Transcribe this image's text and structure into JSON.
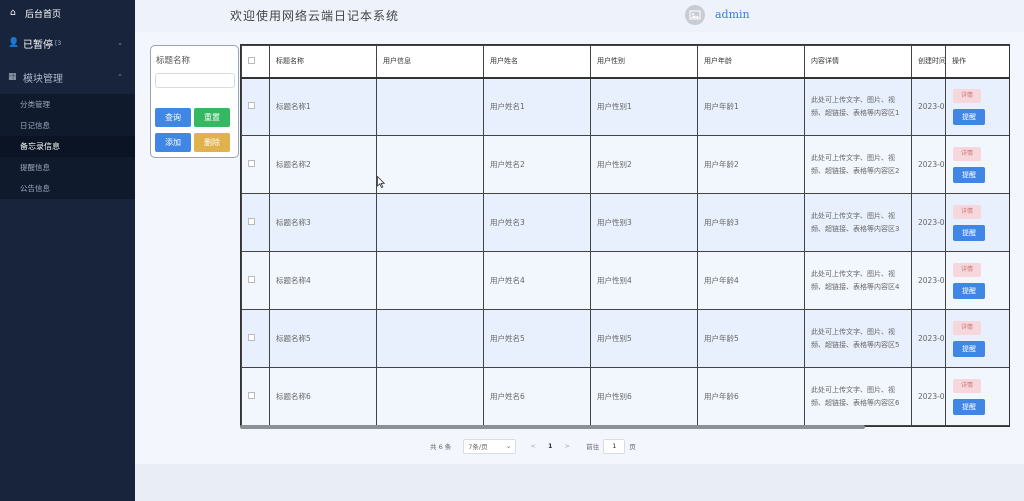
{
  "sidebar": {
    "home": "后台首页",
    "group1": "已暂停",
    "group1_sup": "[3",
    "group2": "模块管理",
    "items": [
      "分类管理",
      "日记信息",
      "备忘录信息",
      "提醒信息",
      "公告信息"
    ],
    "active_index": 2
  },
  "header": {
    "title": "欢迎使用网络云端日记本系统",
    "user": "admin"
  },
  "search": {
    "label": "标题名称",
    "placeholder": "",
    "query": "查询",
    "reset": "重置",
    "add": "添加",
    "delete": "删除"
  },
  "table": {
    "columns": [
      "标题名称",
      "用户信息",
      "用户姓名",
      "用户性别",
      "用户年龄",
      "内容详情",
      "创建时间",
      "操作"
    ],
    "rows": [
      {
        "title": "标题名称1",
        "info": "",
        "name": "用户姓名1",
        "gender": "用户性别1",
        "age": "用户年龄1",
        "detail": "此处可上传文字、图片、视频、超链接、表格等内容区1",
        "created": "2023-0"
      },
      {
        "title": "标题名称2",
        "info": "",
        "name": "用户姓名2",
        "gender": "用户性别2",
        "age": "用户年龄2",
        "detail": "此处可上传文字、图片、视频、超链接、表格等内容区2",
        "created": "2023-0"
      },
      {
        "title": "标题名称3",
        "info": "",
        "name": "用户姓名3",
        "gender": "用户性别3",
        "age": "用户年龄3",
        "detail": "此处可上传文字、图片、视频、超链接、表格等内容区3",
        "created": "2023-0"
      },
      {
        "title": "标题名称4",
        "info": "",
        "name": "用户姓名4",
        "gender": "用户性别4",
        "age": "用户年龄4",
        "detail": "此处可上传文字、图片、视频、超链接、表格等内容区4",
        "created": "2023-0"
      },
      {
        "title": "标题名称5",
        "info": "",
        "name": "用户姓名5",
        "gender": "用户性别5",
        "age": "用户年龄5",
        "detail": "此处可上传文字、图片、视频、超链接、表格等内容区5",
        "created": "2023-0"
      },
      {
        "title": "标题名称6",
        "info": "",
        "name": "用户姓名6",
        "gender": "用户性别6",
        "age": "用户年龄6",
        "detail": "此处可上传文字、图片、视频、超链接、表格等内容区6",
        "created": "2023-0"
      }
    ],
    "op_view": "详情",
    "op_remind": "提醒"
  },
  "pager": {
    "total": "共 6 条",
    "page_size": "7条/页",
    "prev": "<",
    "current": "1",
    "next": ">",
    "goto_label": "前往",
    "goto_value": "1",
    "page_unit": "页"
  },
  "icons": {
    "home": "home-icon",
    "user": "user-icon",
    "grid": "grid-icon",
    "chevron": "chevron-icon",
    "avatar": "image-icon"
  },
  "colors": {
    "sidebar_bg": "#17243c",
    "primary": "#3f86e5",
    "success": "#35b862",
    "warning": "#e0b24d",
    "row_odd": "#e8f0fd"
  }
}
